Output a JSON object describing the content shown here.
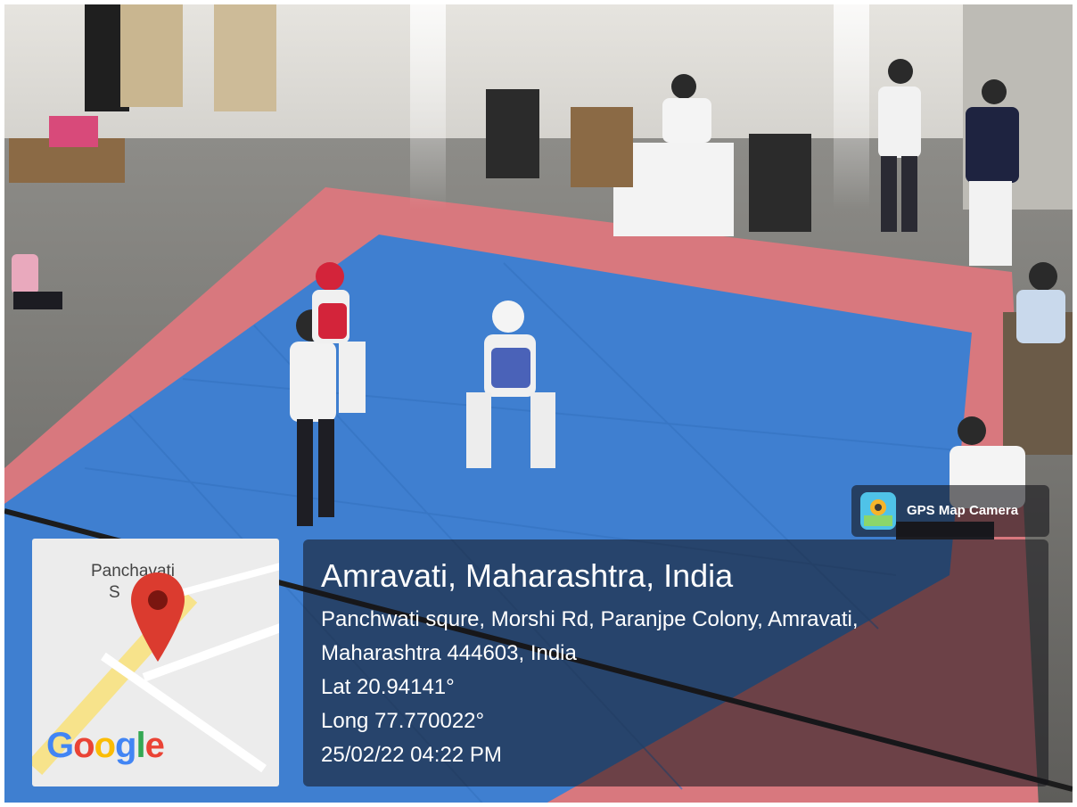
{
  "map": {
    "place_label_line1": "Panchavati",
    "place_label_line2": "S",
    "logo_text": "Google"
  },
  "badge": {
    "label": "GPS Map Camera",
    "icon": "gps-map-camera-app-icon"
  },
  "location": {
    "title": "Amravati, Maharashtra, India",
    "address_line1": "Panchwati squre, Morshi Rd, Paranjpe Colony, Amravati,",
    "address_line2": "Maharashtra 444603, India",
    "lat": "Lat 20.94141°",
    "long": "Long 77.770022°",
    "datetime": "25/02/22 04:22 PM"
  },
  "colors": {
    "mat_blue": "#3f7fd0",
    "mat_red": "#d8787e",
    "pin_red": "#db3b2f",
    "google_blue": "#4285f4",
    "google_red": "#ea4335",
    "google_yellow": "#fbbc05",
    "google_green": "#34a853"
  }
}
